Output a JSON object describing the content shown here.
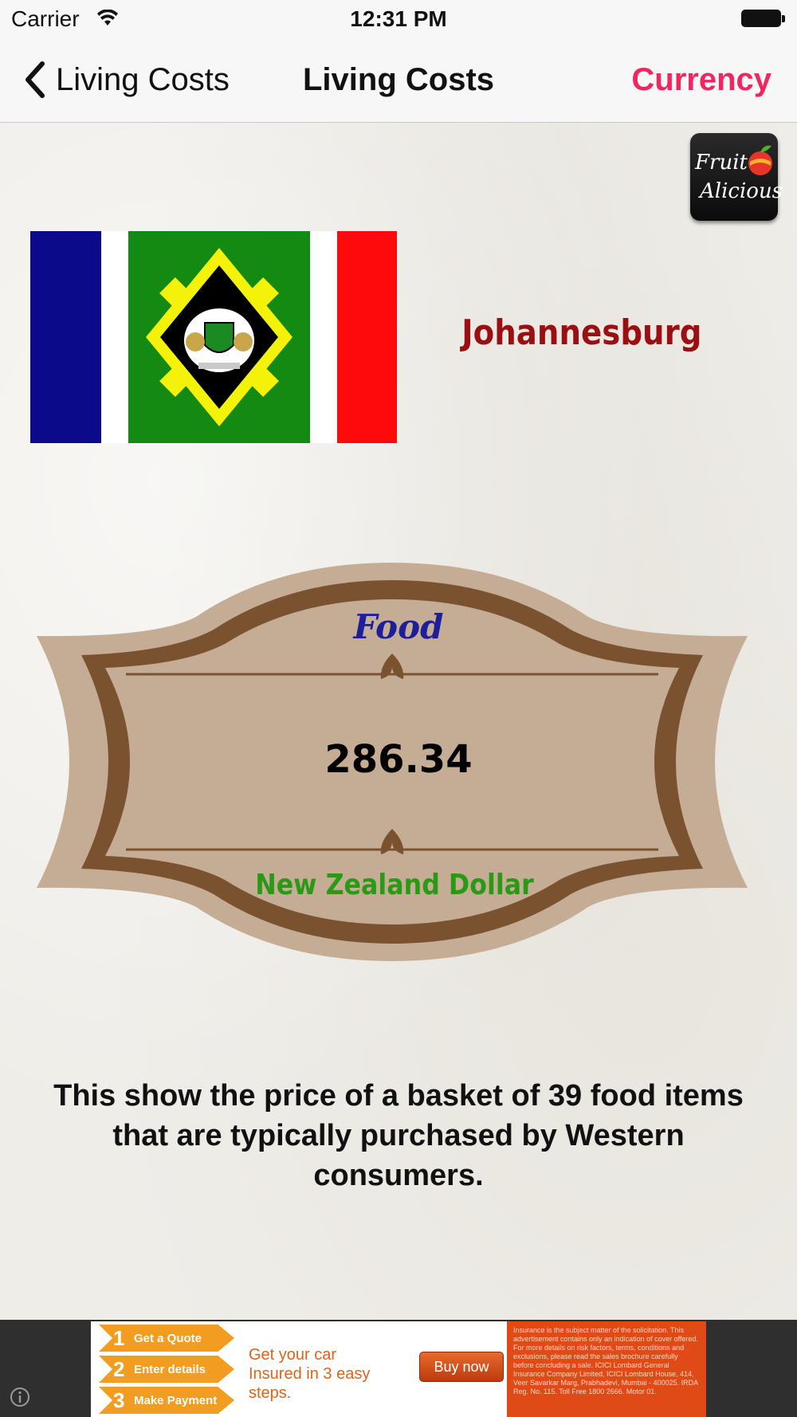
{
  "status_bar": {
    "carrier": "Carrier",
    "time": "12:31 PM"
  },
  "nav": {
    "back_label": "Living Costs",
    "title": "Living Costs",
    "right_button": "Currency"
  },
  "app_logo": {
    "line1": "Fruit",
    "line2": "Alicious"
  },
  "city": {
    "name": "Johannesburg"
  },
  "badge": {
    "title": "Food",
    "value": "286.34",
    "currency": "New Zealand Dollar"
  },
  "description": "This show the price of a basket of 39 food items that are typically purchased by Western consumers.",
  "ad": {
    "steps": [
      {
        "num": "1",
        "label": "Get a Quote"
      },
      {
        "num": "2",
        "label": "Enter details"
      },
      {
        "num": "3",
        "label": "Make Payment"
      }
    ],
    "headline": "Get your car Insured in 3 easy steps.",
    "cta": "Buy now",
    "disclaimer": "Insurance is the subject matter of the solicitation. This advertisement contains only an indication of cover offered. For more details on risk factors, terms, conditions and exclusions, please read the sales brochure carefully before concluding a sale. ICICI Lombard General Insurance Company Limited, ICICI Lombard House, 414, Veer Savarkar Marg, Prabhadevi, Mumbai - 400025. IRDA Reg. No. 115. Toll Free 1800 2666. Motor 01."
  },
  "colors": {
    "accent": "#f0275f",
    "city_name": "#9a0f12",
    "badge_title": "#1c1e9a",
    "currency_text": "#2a9a14"
  }
}
